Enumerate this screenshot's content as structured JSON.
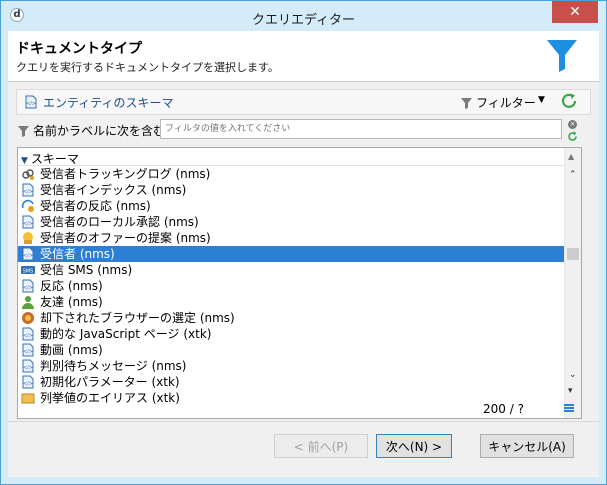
{
  "window": {
    "title": "クエリエディター",
    "close_label": "✕"
  },
  "header": {
    "title": "ドキュメントタイプ",
    "subtitle": "クエリを実行するドキュメントタイプを選択します。"
  },
  "toolbar": {
    "schema_link": "エンティティのスキーマ",
    "filter_label": "フィルター"
  },
  "search": {
    "label": "名前かラベルに次を含む:",
    "placeholder": "フィルタの値を入れてください"
  },
  "list": {
    "header": "スキーマ",
    "items": [
      {
        "label": "受信者トラッキングログ (nms)",
        "icon": "link-person-icon"
      },
      {
        "label": "受信者インデックス (nms)",
        "icon": "document-icon"
      },
      {
        "label": "受信者の反応 (nms)",
        "icon": "reaction-icon"
      },
      {
        "label": "受信者のローカル承認 (nms)",
        "icon": "document-icon"
      },
      {
        "label": "受信者のオファーの提案 (nms)",
        "icon": "offer-icon"
      },
      {
        "label": "受信者 (nms)",
        "icon": "document-icon",
        "selected": true
      },
      {
        "label": "受信 SMS (nms)",
        "icon": "sms-icon"
      },
      {
        "label": "反応 (nms)",
        "icon": "document-icon"
      },
      {
        "label": "友達 (nms)",
        "icon": "person-icon"
      },
      {
        "label": "却下されたブラウザーの選定 (nms)",
        "icon": "browser-icon"
      },
      {
        "label": "動的な JavaScript ページ (xtk)",
        "icon": "document-icon"
      },
      {
        "label": "動画 (nms)",
        "icon": "document-icon"
      },
      {
        "label": "判別待ちメッセージ (nms)",
        "icon": "document-icon"
      },
      {
        "label": "初期化パラメーター (xtk)",
        "icon": "document-icon"
      },
      {
        "label": "列挙値のエイリアス (xtk)",
        "icon": "list-icon"
      }
    ],
    "count": "200 / ?"
  },
  "buttons": {
    "prev": "< 前へ(P)",
    "next": "次へ(N) >",
    "cancel": "キャンセル(A)"
  },
  "colors": {
    "selection": "#2c7fd4",
    "accent": "#1d8fe0",
    "refresh": "#3aa64a"
  }
}
